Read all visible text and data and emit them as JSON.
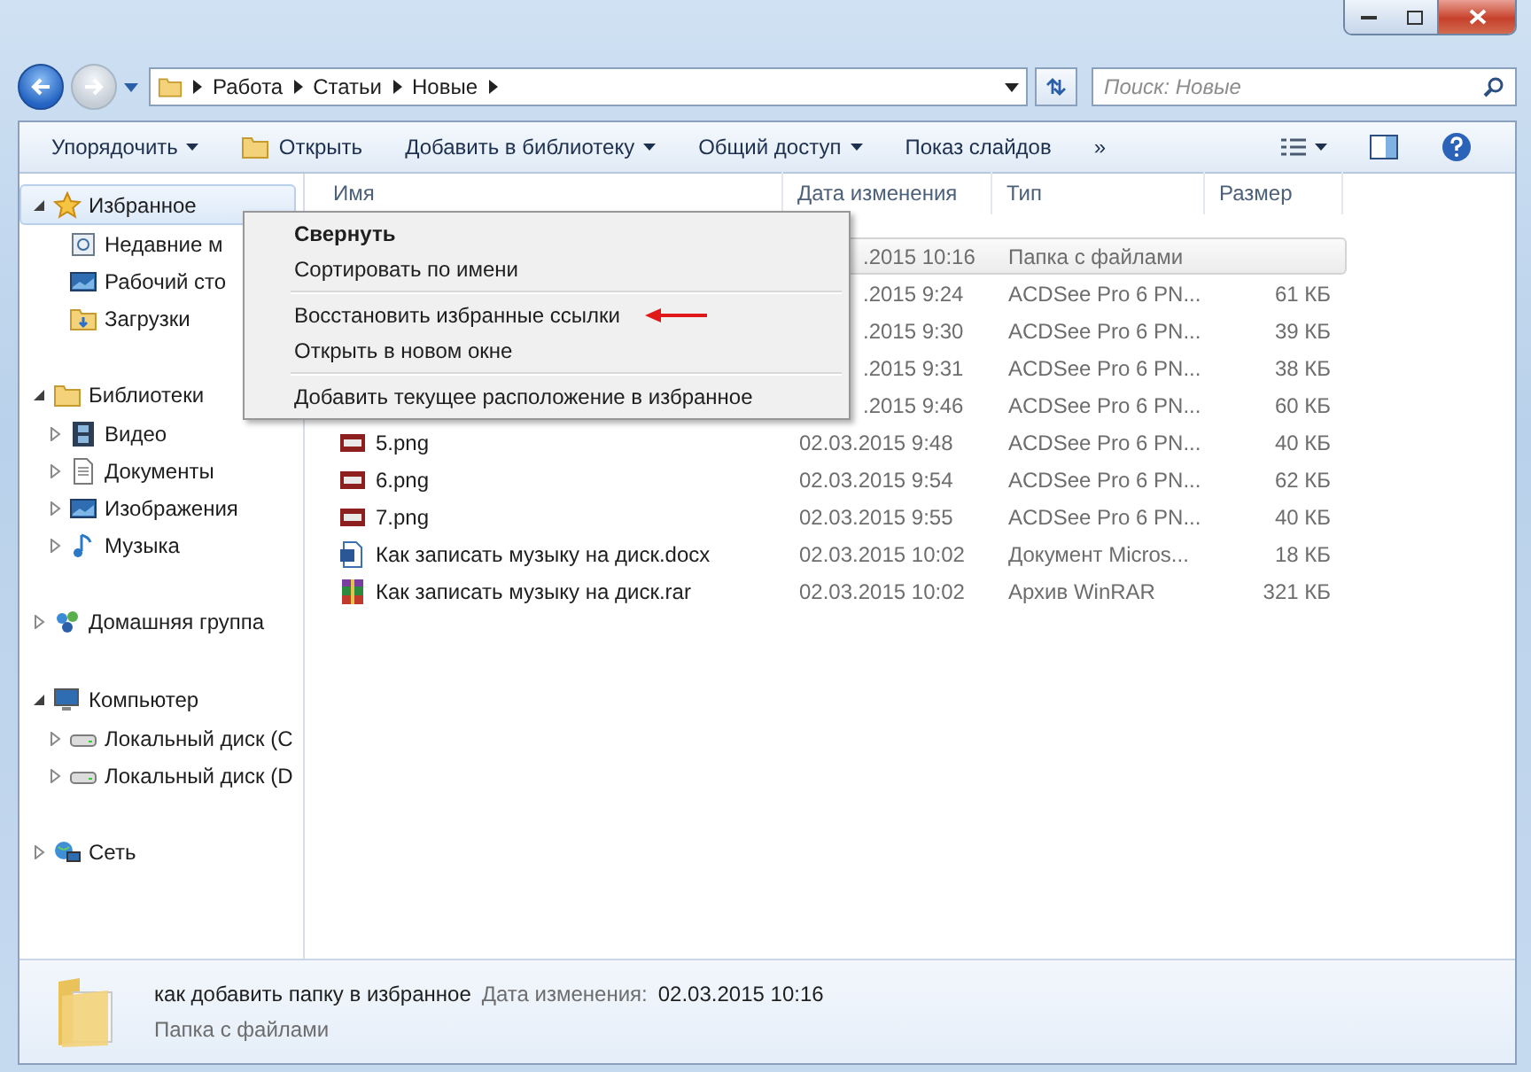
{
  "address": {
    "crumbs": [
      "Работа",
      "Статьи",
      "Новые"
    ],
    "search_placeholder": "Поиск: Новые"
  },
  "toolbar": {
    "items": [
      {
        "label": "Упорядочить",
        "dropdown": true,
        "kind": "plain"
      },
      {
        "label": "Открыть",
        "dropdown": false,
        "kind": "folder"
      },
      {
        "label": "Добавить в библиотеку",
        "dropdown": true,
        "kind": "plain"
      },
      {
        "label": "Общий доступ",
        "dropdown": true,
        "kind": "plain"
      },
      {
        "label": "Показ слайдов",
        "dropdown": false,
        "kind": "plain"
      }
    ],
    "more": "»"
  },
  "sidebar": {
    "groups": [
      {
        "label": "Избранное",
        "expanded": true,
        "selected": true,
        "kind": "star",
        "children": [
          {
            "label": "Недавние м",
            "kind": "recent"
          },
          {
            "label": "Рабочий сто",
            "kind": "desktop"
          },
          {
            "label": "Загрузки",
            "kind": "downloads"
          }
        ]
      },
      {
        "label": "Библиотеки",
        "expanded": true,
        "selected": false,
        "kind": "library",
        "children": [
          {
            "label": "Видео",
            "kind": "video",
            "expanded": false
          },
          {
            "label": "Документы",
            "kind": "docs",
            "expanded": false
          },
          {
            "label": "Изображения",
            "kind": "images",
            "expanded": false
          },
          {
            "label": "Музыка",
            "kind": "music",
            "expanded": false
          }
        ]
      },
      {
        "label": "Домашняя группа",
        "expanded": false,
        "selected": false,
        "kind": "homegroup"
      },
      {
        "label": "Компьютер",
        "expanded": true,
        "selected": false,
        "kind": "computer",
        "children": [
          {
            "label": "Локальный диск (C",
            "kind": "drive",
            "expanded": false
          },
          {
            "label": "Локальный диск (D",
            "kind": "drive",
            "expanded": false
          }
        ]
      },
      {
        "label": "Сеть",
        "expanded": false,
        "selected": false,
        "kind": "network"
      }
    ]
  },
  "table": {
    "columns": [
      "Имя",
      "Дата изменения",
      "Тип",
      "Размер"
    ],
    "rows": [
      {
        "covered": true,
        "selected": true,
        "date": ".2015 10:16",
        "type": "Папка с файлами"
      },
      {
        "covered": true,
        "selected": false,
        "date": ".2015 9:24",
        "type": "ACDSee Pro 6 PN...",
        "size": "61 КБ"
      },
      {
        "covered": true,
        "selected": false,
        "date": ".2015 9:30",
        "type": "ACDSee Pro 6 PN...",
        "size": "39 КБ"
      },
      {
        "covered": true,
        "selected": false,
        "date": ".2015 9:31",
        "type": "ACDSee Pro 6 PN...",
        "size": "38 КБ"
      },
      {
        "covered": true,
        "selected": false,
        "date": ".2015 9:46",
        "type": "ACDSee Pro 6 PN...",
        "size": "60 КБ"
      },
      {
        "covered": false,
        "selected": false,
        "kind": "image",
        "name": "5.png",
        "date": "02.03.2015 9:48",
        "type": "ACDSee Pro 6 PN...",
        "size": "40 КБ"
      },
      {
        "covered": false,
        "selected": false,
        "kind": "image",
        "name": "6.png",
        "date": "02.03.2015 9:54",
        "type": "ACDSee Pro 6 PN...",
        "size": "62 КБ"
      },
      {
        "covered": false,
        "selected": false,
        "kind": "image",
        "name": "7.png",
        "date": "02.03.2015 9:55",
        "type": "ACDSee Pro 6 PN...",
        "size": "40 КБ"
      },
      {
        "covered": false,
        "selected": false,
        "kind": "document",
        "name": "Как записать музыку на диск.docx",
        "date": "02.03.2015 10:02",
        "type": "Документ Micros...",
        "size": "18 КБ"
      },
      {
        "covered": false,
        "selected": false,
        "kind": "archive",
        "name": "Как записать музыку на диск.rar",
        "date": "02.03.2015 10:02",
        "type": "Архив WinRAR",
        "size": "321 КБ"
      }
    ]
  },
  "context_menu": {
    "groups": [
      [
        {
          "label": "Свернуть",
          "default": true,
          "annotated": false
        },
        {
          "label": "Сортировать по имени",
          "default": false,
          "annotated": false
        }
      ],
      [
        {
          "label": "Восстановить избранные ссылки",
          "default": false,
          "annotated": true
        },
        {
          "label": "Открыть в новом окне",
          "default": false,
          "annotated": false
        }
      ],
      [
        {
          "label": "Добавить текущее расположение в избранное",
          "default": false,
          "annotated": false
        }
      ]
    ]
  },
  "details": {
    "name": "как добавить папку в избранное",
    "date_label": "Дата изменения:",
    "date": "02.03.2015 10:16",
    "type": "Папка с файлами"
  }
}
